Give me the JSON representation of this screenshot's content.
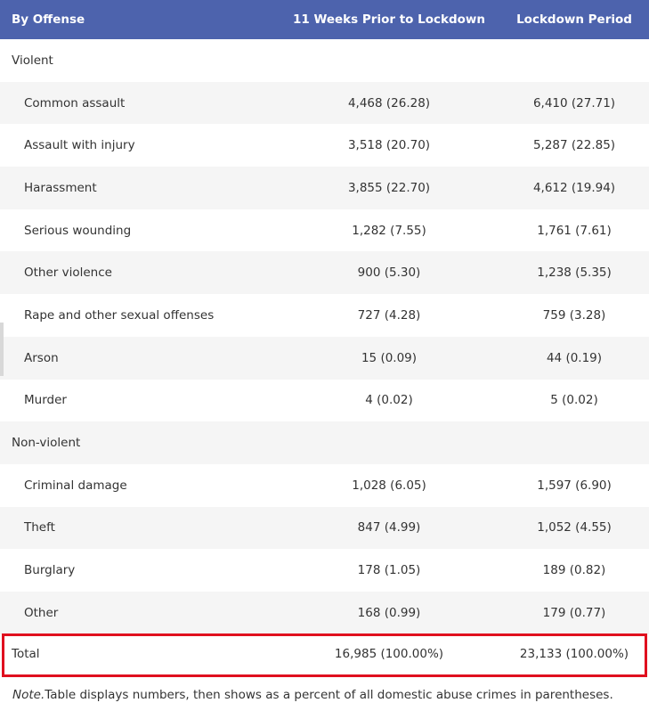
{
  "headers": {
    "offense": "By Offense",
    "prior": "11 Weeks Prior to Lockdown",
    "lockdown": "Lockdown Period"
  },
  "groups": [
    {
      "category": "Violent",
      "rows": [
        {
          "label": "Common assault",
          "prior": "4,468 (26.28)",
          "lockdown": "6,410 (27.71)"
        },
        {
          "label": "Assault with injury",
          "prior": "3,518 (20.70)",
          "lockdown": "5,287 (22.85)"
        },
        {
          "label": "Harassment",
          "prior": "3,855 (22.70)",
          "lockdown": "4,612 (19.94)"
        },
        {
          "label": "Serious wounding",
          "prior": "1,282 (7.55)",
          "lockdown": "1,761 (7.61)"
        },
        {
          "label": "Other violence",
          "prior": "900 (5.30)",
          "lockdown": "1,238 (5.35)"
        },
        {
          "label": "Rape and other sexual offenses",
          "prior": "727 (4.28)",
          "lockdown": "759 (3.28)"
        },
        {
          "label": "Arson",
          "prior": "15 (0.09)",
          "lockdown": "44 (0.19)"
        },
        {
          "label": "Murder",
          "prior": "4 (0.02)",
          "lockdown": "5 (0.02)"
        }
      ]
    },
    {
      "category": "Non-violent",
      "rows": [
        {
          "label": "Criminal damage",
          "prior": "1,028 (6.05)",
          "lockdown": "1,597 (6.90)"
        },
        {
          "label": "Theft",
          "prior": "847 (4.99)",
          "lockdown": "1,052 (4.55)"
        },
        {
          "label": "Burglary",
          "prior": "178 (1.05)",
          "lockdown": "189 (0.82)"
        },
        {
          "label": "Other",
          "prior": "168 (0.99)",
          "lockdown": "179 (0.77)"
        }
      ]
    }
  ],
  "total": {
    "label": "Total",
    "prior": "16,985 (100.00%)",
    "lockdown": "23,133 (100.00%)"
  },
  "note": {
    "prefix": "Note.",
    "text": "Table displays numbers, then shows as a percent of all domestic abuse crimes in parentheses."
  },
  "colors": {
    "header_bg": "#4d63ad",
    "stripe": "#f5f5f5",
    "highlight_border": "#e0101e"
  }
}
